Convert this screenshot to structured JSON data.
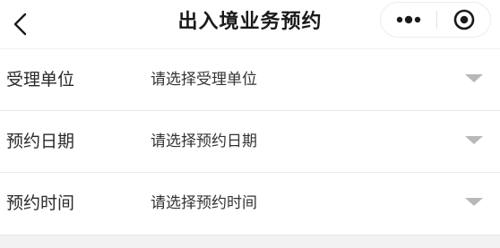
{
  "nav": {
    "title": "出入境业务预约",
    "back_icon": "chevron-left-icon",
    "more_icon": "more-dots-icon",
    "close_icon": "target-circle-icon"
  },
  "form": {
    "rows": [
      {
        "label": "受理单位",
        "placeholder": "请选择受理单位"
      },
      {
        "label": "预约日期",
        "placeholder": "请选择预约日期"
      },
      {
        "label": "预约时间",
        "placeholder": "请选择预约时间"
      }
    ]
  },
  "colors": {
    "background": "#f2f2f2",
    "surface": "#ffffff",
    "title_text": "#1a1a1a",
    "arrow": "#b8b8b8"
  }
}
